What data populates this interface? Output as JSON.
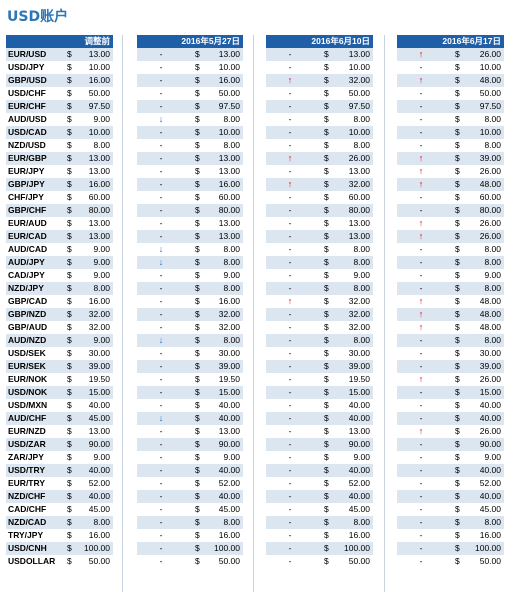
{
  "title": "USD账户",
  "base_header": "调整前",
  "currency_symbol": "$",
  "pairs": [
    "EUR/USD",
    "USD/JPY",
    "GBP/USD",
    "USD/CHF",
    "EUR/CHF",
    "AUD/USD",
    "USD/CAD",
    "NZD/USD",
    "EUR/GBP",
    "EUR/JPY",
    "GBP/JPY",
    "CHF/JPY",
    "GBP/CHF",
    "EUR/AUD",
    "EUR/CAD",
    "AUD/CAD",
    "AUD/JPY",
    "CAD/JPY",
    "NZD/JPY",
    "GBP/CAD",
    "GBP/NZD",
    "GBP/AUD",
    "AUD/NZD",
    "USD/SEK",
    "EUR/SEK",
    "EUR/NOK",
    "USD/NOK",
    "USD/MXN",
    "AUD/CHF",
    "EUR/NZD",
    "USD/ZAR",
    "ZAR/JPY",
    "USD/TRY",
    "EUR/TRY",
    "NZD/CHF",
    "CAD/CHF",
    "NZD/CAD",
    "TRY/JPY",
    "USD/CNH",
    "USDOLLAR"
  ],
  "base_values": [
    "13.00",
    "10.00",
    "16.00",
    "50.00",
    "97.50",
    "9.00",
    "10.00",
    "8.00",
    "13.00",
    "13.00",
    "16.00",
    "60.00",
    "80.00",
    "13.00",
    "13.00",
    "9.00",
    "9.00",
    "9.00",
    "8.00",
    "16.00",
    "32.00",
    "32.00",
    "9.00",
    "30.00",
    "39.00",
    "19.50",
    "15.00",
    "40.00",
    "45.00",
    "13.00",
    "90.00",
    "9.00",
    "40.00",
    "52.00",
    "40.00",
    "45.00",
    "8.00",
    "16.00",
    "100.00",
    "50.00"
  ],
  "periods": [
    {
      "header": "2016年5月27日",
      "indicators": [
        "-",
        "-",
        "-",
        "-",
        "-",
        "down",
        "-",
        "-",
        "-",
        "-",
        "-",
        "-",
        "-",
        "-",
        "-",
        "down",
        "down",
        "-",
        "-",
        "-",
        "-",
        "-",
        "down",
        "-",
        "-",
        "-",
        "-",
        "-",
        "down",
        "-",
        "-",
        "-",
        "-",
        "-",
        "-",
        "-",
        "-",
        "-",
        "-",
        "-"
      ],
      "values": [
        "13.00",
        "10.00",
        "16.00",
        "50.00",
        "97.50",
        "8.00",
        "10.00",
        "8.00",
        "13.00",
        "13.00",
        "16.00",
        "60.00",
        "80.00",
        "13.00",
        "13.00",
        "8.00",
        "8.00",
        "9.00",
        "8.00",
        "16.00",
        "32.00",
        "32.00",
        "8.00",
        "30.00",
        "39.00",
        "19.50",
        "15.00",
        "40.00",
        "40.00",
        "13.00",
        "90.00",
        "9.00",
        "40.00",
        "52.00",
        "40.00",
        "45.00",
        "8.00",
        "16.00",
        "100.00",
        "50.00"
      ]
    },
    {
      "header": "2016年6月10日",
      "indicators": [
        "-",
        "-",
        "up",
        "-",
        "-",
        "-",
        "-",
        "-",
        "up",
        "-",
        "up",
        "-",
        "-",
        "-",
        "-",
        "-",
        "-",
        "-",
        "-",
        "up",
        "-",
        "-",
        "-",
        "-",
        "-",
        "-",
        "-",
        "-",
        "-",
        "-",
        "-",
        "-",
        "-",
        "-",
        "-",
        "-",
        "-",
        "-",
        "-",
        "-"
      ],
      "values": [
        "13.00",
        "10.00",
        "32.00",
        "50.00",
        "97.50",
        "8.00",
        "10.00",
        "8.00",
        "26.00",
        "13.00",
        "32.00",
        "60.00",
        "80.00",
        "13.00",
        "13.00",
        "8.00",
        "8.00",
        "9.00",
        "8.00",
        "32.00",
        "32.00",
        "32.00",
        "8.00",
        "30.00",
        "39.00",
        "19.50",
        "15.00",
        "40.00",
        "40.00",
        "13.00",
        "90.00",
        "9.00",
        "40.00",
        "52.00",
        "40.00",
        "45.00",
        "8.00",
        "16.00",
        "100.00",
        "50.00"
      ]
    },
    {
      "header": "2016年6月17日",
      "indicators": [
        "up",
        "-",
        "up",
        "-",
        "-",
        "-",
        "-",
        "-",
        "up",
        "up",
        "up",
        "-",
        "-",
        "up",
        "up",
        "-",
        "-",
        "-",
        "-",
        "up",
        "up",
        "up",
        "-",
        "-",
        "-",
        "up",
        "-",
        "-",
        "-",
        "up",
        "-",
        "-",
        "-",
        "-",
        "-",
        "-",
        "-",
        "-",
        "-",
        "-"
      ],
      "values": [
        "26.00",
        "10.00",
        "48.00",
        "50.00",
        "97.50",
        "8.00",
        "10.00",
        "8.00",
        "39.00",
        "26.00",
        "48.00",
        "60.00",
        "80.00",
        "26.00",
        "26.00",
        "8.00",
        "8.00",
        "9.00",
        "8.00",
        "48.00",
        "48.00",
        "48.00",
        "8.00",
        "30.00",
        "39.00",
        "26.00",
        "15.00",
        "40.00",
        "40.00",
        "26.00",
        "90.00",
        "9.00",
        "40.00",
        "52.00",
        "40.00",
        "45.00",
        "8.00",
        "16.00",
        "100.00",
        "50.00"
      ]
    }
  ],
  "indicator_glyphs": {
    "up": "↑",
    "down": "↓",
    "-": "-"
  },
  "colors": {
    "title": "#2e75b6",
    "header_bg": "#1f5fa8",
    "band": "#dce6f1",
    "up_arrow": "#e00000",
    "down_arrow": "#1a6fd1"
  }
}
